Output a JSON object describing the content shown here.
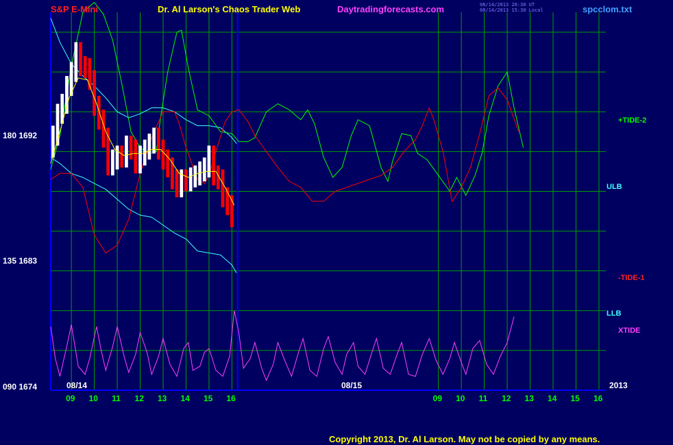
{
  "header": {
    "symbol": "S&P E-Mini",
    "site_title": "Dr. Al Larson's Chaos Trader Web",
    "site_url": "Daytradingforecasts.com",
    "stamp_line1": "08/14/2013 20:30 UT",
    "stamp_line2": "08/14/2013 15:30 Local",
    "filename": "spcclom.txt"
  },
  "colors": {
    "background": "#000060",
    "grid": "#00a000",
    "axis": "#0000ff",
    "price_up": "#ffffff",
    "price_down": "#ff0000",
    "average": "#ffff00",
    "band": "#40ffff",
    "tide2": "#00ff00",
    "tide1": "#ff0000",
    "xtide": "#ff40ff"
  },
  "y_axis": {
    "labels": [
      {
        "text": "180  1692",
        "price": 1692
      },
      {
        "text": "135  1683",
        "price": 1683
      },
      {
        "text": "090  1674",
        "price": 1674
      }
    ]
  },
  "date_labels": [
    {
      "text": "08/14",
      "hour": 8.3
    },
    {
      "text": "08/15",
      "hour": 24.3
    },
    {
      "text": "2013",
      "hour": 32.15
    }
  ],
  "right_labels": {
    "tide2": "+TIDE-2",
    "ulb": "ULB",
    "tide1": "-TIDE-1",
    "llb": "LLB",
    "xtide": "XTIDE"
  },
  "copyright": "Copyright 2013, Dr. Al Larson. May not be copied by any means.",
  "chart_data": {
    "type": "line",
    "title": "S&P E-Mini",
    "x_unit": "hour (session hours, 08/14 then 08/15)",
    "xlim": [
      8.1,
      32.3
    ],
    "ylim": [
      1674,
      1693
    ],
    "x_ticks": [
      {
        "label": "09",
        "hour": 9
      },
      {
        "label": "10",
        "hour": 10
      },
      {
        "label": "11",
        "hour": 11
      },
      {
        "label": "12",
        "hour": 12
      },
      {
        "label": "13",
        "hour": 13
      },
      {
        "label": "14",
        "hour": 14
      },
      {
        "label": "15",
        "hour": 15
      },
      {
        "label": "16",
        "hour": 16
      },
      {
        "label": "09",
        "hour": 25
      },
      {
        "label": "10",
        "hour": 26
      },
      {
        "label": "11",
        "hour": 27
      },
      {
        "label": "12",
        "hour": 28
      },
      {
        "label": "13",
        "hour": 29
      },
      {
        "label": "14",
        "hour": 30
      },
      {
        "label": "15",
        "hour": 31
      },
      {
        "label": "16",
        "hour": 32
      }
    ],
    "session_divider_hour": 16.25,
    "price": {
      "name": "S&P E-Mini",
      "points": [
        [
          8.1,
          1686.2
        ],
        [
          8.3,
          1686.8
        ],
        [
          8.5,
          1687.9
        ],
        [
          8.7,
          1688.4
        ],
        [
          8.9,
          1689.3
        ],
        [
          9.1,
          1690.0
        ],
        [
          9.3,
          1691.0
        ],
        [
          9.5,
          1690.3
        ],
        [
          9.7,
          1690.2
        ],
        [
          9.9,
          1689.6
        ],
        [
          10.1,
          1688.3
        ],
        [
          10.3,
          1687.6
        ],
        [
          10.5,
          1686.7
        ],
        [
          10.7,
          1685.3
        ],
        [
          10.9,
          1685.6
        ],
        [
          11.1,
          1685.8
        ],
        [
          11.3,
          1685.7
        ],
        [
          11.5,
          1686.3
        ],
        [
          11.7,
          1686.1
        ],
        [
          11.9,
          1685.4
        ],
        [
          12.1,
          1685.8
        ],
        [
          12.3,
          1686.1
        ],
        [
          12.5,
          1686.4
        ],
        [
          12.7,
          1686.7
        ],
        [
          12.9,
          1686.1
        ],
        [
          13.1,
          1685.6
        ],
        [
          13.3,
          1685.2
        ],
        [
          13.5,
          1684.6
        ],
        [
          13.7,
          1684.2
        ],
        [
          13.9,
          1684.6
        ],
        [
          14.1,
          1684.5
        ],
        [
          14.3,
          1684.7
        ],
        [
          14.5,
          1684.8
        ],
        [
          14.7,
          1685.0
        ],
        [
          14.9,
          1685.2
        ],
        [
          15.1,
          1685.8
        ],
        [
          15.3,
          1684.8
        ],
        [
          15.5,
          1684.6
        ],
        [
          15.7,
          1683.7
        ],
        [
          15.9,
          1683.3
        ],
        [
          16.1,
          1682.7
        ]
      ]
    },
    "average": {
      "name": "Average",
      "points": [
        [
          8.1,
          1685.4
        ],
        [
          8.5,
          1687.0
        ],
        [
          8.9,
          1688.7
        ],
        [
          9.3,
          1689.7
        ],
        [
          9.7,
          1689.6
        ],
        [
          10.1,
          1688.4
        ],
        [
          10.5,
          1687.0
        ],
        [
          10.9,
          1686.1
        ],
        [
          11.3,
          1685.8
        ],
        [
          11.7,
          1685.9
        ],
        [
          12.1,
          1685.9
        ],
        [
          12.5,
          1686.1
        ],
        [
          12.9,
          1686.1
        ],
        [
          13.3,
          1685.6
        ],
        [
          13.7,
          1684.9
        ],
        [
          14.1,
          1684.7
        ],
        [
          14.5,
          1684.9
        ],
        [
          14.9,
          1685.0
        ],
        [
          15.3,
          1685.0
        ],
        [
          15.7,
          1684.2
        ],
        [
          16.1,
          1683.3
        ]
      ]
    },
    "series": [
      {
        "name": "ULB",
        "color": "#40ffff",
        "points": [
          [
            8.1,
            1692.7
          ],
          [
            8.5,
            1691.5
          ],
          [
            9.0,
            1690.4
          ],
          [
            9.5,
            1689.8
          ],
          [
            10.0,
            1689.3
          ],
          [
            10.5,
            1688.7
          ],
          [
            11.0,
            1688.0
          ],
          [
            11.5,
            1687.7
          ],
          [
            12.0,
            1687.9
          ],
          [
            12.5,
            1688.2
          ],
          [
            13.0,
            1688.2
          ],
          [
            13.5,
            1688.0
          ],
          [
            14.0,
            1687.6
          ],
          [
            14.5,
            1687.3
          ],
          [
            15.0,
            1687.3
          ],
          [
            15.5,
            1687.2
          ],
          [
            16.0,
            1686.7
          ],
          [
            16.2,
            1686.4
          ]
        ]
      },
      {
        "name": "LLB",
        "color": "#40ffff",
        "points": [
          [
            8.1,
            1685.7
          ],
          [
            8.5,
            1685.4
          ],
          [
            9.0,
            1684.9
          ],
          [
            9.5,
            1684.7
          ],
          [
            10.0,
            1684.4
          ],
          [
            10.5,
            1684.1
          ],
          [
            11.0,
            1683.6
          ],
          [
            11.5,
            1683.1
          ],
          [
            12.0,
            1682.8
          ],
          [
            12.5,
            1682.7
          ],
          [
            13.0,
            1682.3
          ],
          [
            13.5,
            1681.9
          ],
          [
            14.0,
            1681.6
          ],
          [
            14.5,
            1681.0
          ],
          [
            15.0,
            1680.9
          ],
          [
            15.5,
            1680.8
          ],
          [
            16.0,
            1680.3
          ],
          [
            16.2,
            1679.9
          ]
        ]
      },
      {
        "name": "+TIDE-2",
        "color": "#00ff00",
        "points": [
          [
            8.1,
            1685.1
          ],
          [
            8.5,
            1686.8
          ],
          [
            9.0,
            1690.3
          ],
          [
            9.5,
            1693.0
          ],
          [
            10.0,
            1693.5
          ],
          [
            10.4,
            1692.9
          ],
          [
            10.8,
            1691.6
          ],
          [
            11.2,
            1689.4
          ],
          [
            11.6,
            1687.0
          ],
          [
            12.0,
            1686.2
          ],
          [
            12.4,
            1685.9
          ],
          [
            12.7,
            1686.0
          ],
          [
            12.9,
            1687.8
          ],
          [
            13.2,
            1690.0
          ],
          [
            13.6,
            1692.0
          ],
          [
            13.8,
            1692.1
          ],
          [
            14.1,
            1690.2
          ],
          [
            14.5,
            1688.1
          ],
          [
            15.0,
            1687.8
          ],
          [
            15.5,
            1687.0
          ],
          [
            16.0,
            1686.9
          ],
          [
            16.3,
            1686.5
          ],
          [
            16.7,
            1686.5
          ],
          [
            17.0,
            1686.7
          ],
          [
            17.5,
            1688.0
          ],
          [
            18.0,
            1688.4
          ],
          [
            18.5,
            1688.1
          ],
          [
            19.0,
            1687.6
          ],
          [
            19.3,
            1688.1
          ],
          [
            19.6,
            1687.4
          ],
          [
            20.0,
            1685.7
          ],
          [
            20.4,
            1684.7
          ],
          [
            20.8,
            1685.2
          ],
          [
            21.2,
            1686.8
          ],
          [
            21.5,
            1687.6
          ],
          [
            22.0,
            1687.3
          ],
          [
            22.5,
            1685.2
          ],
          [
            22.8,
            1684.5
          ],
          [
            23.0,
            1685.5
          ],
          [
            23.4,
            1686.9
          ],
          [
            23.8,
            1686.8
          ],
          [
            24.1,
            1685.9
          ],
          [
            24.5,
            1685.6
          ],
          [
            25.0,
            1684.8
          ],
          [
            25.5,
            1684.0
          ],
          [
            25.8,
            1684.7
          ],
          [
            26.2,
            1683.8
          ],
          [
            26.6,
            1684.8
          ],
          [
            26.9,
            1685.9
          ],
          [
            27.2,
            1687.8
          ],
          [
            27.6,
            1689.3
          ],
          [
            28.0,
            1690.0
          ],
          [
            28.3,
            1688.2
          ],
          [
            28.7,
            1686.2
          ]
        ]
      },
      {
        "name": "-TIDE-1",
        "color": "#ff0000",
        "points": [
          [
            8.1,
            1684.6
          ],
          [
            8.5,
            1684.9
          ],
          [
            9.0,
            1684.9
          ],
          [
            9.5,
            1684.2
          ],
          [
            10.0,
            1681.8
          ],
          [
            10.5,
            1680.9
          ],
          [
            11.0,
            1681.3
          ],
          [
            11.5,
            1682.6
          ],
          [
            12.0,
            1684.9
          ],
          [
            12.5,
            1686.7
          ],
          [
            13.0,
            1688.0
          ],
          [
            13.5,
            1688.0
          ],
          [
            13.7,
            1687.4
          ],
          [
            14.0,
            1686.2
          ],
          [
            14.5,
            1684.6
          ],
          [
            14.8,
            1684.4
          ],
          [
            15.0,
            1684.8
          ],
          [
            15.3,
            1686.0
          ],
          [
            15.7,
            1687.5
          ],
          [
            16.0,
            1688.0
          ],
          [
            16.3,
            1688.1
          ],
          [
            16.7,
            1687.5
          ],
          [
            17.0,
            1686.8
          ],
          [
            17.5,
            1686.0
          ],
          [
            18.0,
            1685.2
          ],
          [
            18.5,
            1684.5
          ],
          [
            19.0,
            1684.2
          ],
          [
            19.5,
            1683.5
          ],
          [
            20.0,
            1683.5
          ],
          [
            20.5,
            1684.0
          ],
          [
            21.0,
            1684.2
          ],
          [
            21.5,
            1684.4
          ],
          [
            22.0,
            1684.6
          ],
          [
            22.5,
            1684.8
          ],
          [
            23.0,
            1685.2
          ],
          [
            23.5,
            1686.0
          ],
          [
            24.0,
            1686.6
          ],
          [
            24.3,
            1687.3
          ],
          [
            24.6,
            1688.2
          ],
          [
            24.8,
            1687.6
          ],
          [
            25.2,
            1686.0
          ],
          [
            25.6,
            1683.5
          ],
          [
            26.0,
            1684.2
          ],
          [
            26.4,
            1685.2
          ],
          [
            26.8,
            1686.9
          ],
          [
            27.2,
            1688.8
          ],
          [
            27.6,
            1689.2
          ],
          [
            28.0,
            1688.6
          ],
          [
            28.5,
            1687.0
          ]
        ]
      },
      {
        "name": "XTIDE",
        "color": "#ff40ff",
        "points": [
          [
            8.1,
            1677.2
          ],
          [
            8.3,
            1675.6
          ],
          [
            8.5,
            1674.7
          ],
          [
            8.8,
            1676.2
          ],
          [
            9.0,
            1677.3
          ],
          [
            9.3,
            1675.2
          ],
          [
            9.6,
            1674.8
          ],
          [
            9.8,
            1675.6
          ],
          [
            10.1,
            1677.2
          ],
          [
            10.3,
            1676.0
          ],
          [
            10.5,
            1675.0
          ],
          [
            10.8,
            1676.2
          ],
          [
            11.0,
            1677.2
          ],
          [
            11.3,
            1675.7
          ],
          [
            11.5,
            1674.9
          ],
          [
            11.8,
            1675.8
          ],
          [
            12.0,
            1676.9
          ],
          [
            12.3,
            1675.9
          ],
          [
            12.5,
            1674.8
          ],
          [
            12.8,
            1675.7
          ],
          [
            13.0,
            1676.6
          ],
          [
            13.3,
            1675.3
          ],
          [
            13.6,
            1674.7
          ],
          [
            13.9,
            1676.1
          ],
          [
            14.1,
            1676.4
          ],
          [
            14.3,
            1675.0
          ],
          [
            14.6,
            1675.2
          ],
          [
            14.8,
            1675.9
          ],
          [
            15.0,
            1676.1
          ],
          [
            15.3,
            1675.0
          ],
          [
            15.6,
            1674.7
          ],
          [
            15.9,
            1675.7
          ],
          [
            16.1,
            1678.0
          ],
          [
            16.3,
            1676.9
          ],
          [
            16.5,
            1675.1
          ],
          [
            16.8,
            1675.6
          ],
          [
            17.0,
            1676.4
          ],
          [
            17.3,
            1675.1
          ],
          [
            17.5,
            1674.5
          ],
          [
            17.8,
            1675.3
          ],
          [
            18.0,
            1676.4
          ],
          [
            18.3,
            1675.5
          ],
          [
            18.6,
            1674.7
          ],
          [
            18.9,
            1675.9
          ],
          [
            19.1,
            1676.6
          ],
          [
            19.4,
            1675.0
          ],
          [
            19.7,
            1674.7
          ],
          [
            20.0,
            1676.1
          ],
          [
            20.2,
            1676.7
          ],
          [
            20.5,
            1675.4
          ],
          [
            20.8,
            1674.8
          ],
          [
            21.0,
            1675.8
          ],
          [
            21.3,
            1676.4
          ],
          [
            21.5,
            1675.2
          ],
          [
            21.8,
            1674.8
          ],
          [
            22.1,
            1675.9
          ],
          [
            22.3,
            1676.6
          ],
          [
            22.6,
            1675.1
          ],
          [
            22.9,
            1674.8
          ],
          [
            23.2,
            1675.8
          ],
          [
            23.4,
            1676.4
          ],
          [
            23.7,
            1674.8
          ],
          [
            24.0,
            1674.7
          ],
          [
            24.3,
            1675.8
          ],
          [
            24.6,
            1676.6
          ],
          [
            24.9,
            1675.5
          ],
          [
            25.2,
            1674.8
          ],
          [
            25.5,
            1675.6
          ],
          [
            25.7,
            1676.4
          ],
          [
            26.0,
            1675.4
          ],
          [
            26.2,
            1674.8
          ],
          [
            26.5,
            1676.1
          ],
          [
            26.8,
            1676.5
          ],
          [
            27.1,
            1675.3
          ],
          [
            27.4,
            1674.8
          ],
          [
            27.7,
            1675.7
          ],
          [
            28.0,
            1676.4
          ],
          [
            28.3,
            1677.7
          ]
        ]
      }
    ]
  }
}
